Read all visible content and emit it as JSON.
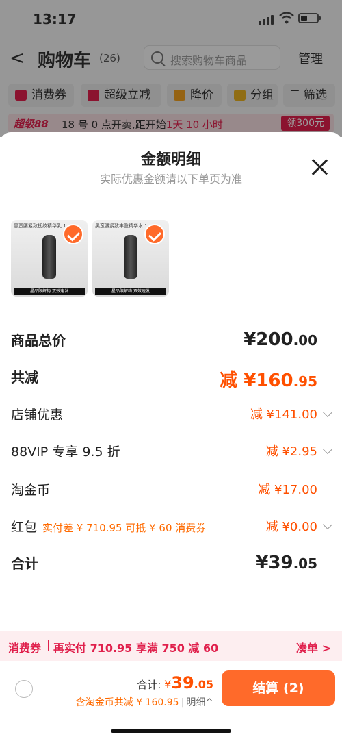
{
  "status_bar": {
    "time": "13:17"
  },
  "nav": {
    "back": "<",
    "title": "购物车",
    "count": "(26)",
    "search_placeholder": "搜索购物车商品",
    "manage": "管理"
  },
  "filters": [
    {
      "label": "消费券",
      "icon": "coupon-icon",
      "color": "#e0204c"
    },
    {
      "label": "超级立减",
      "icon": "arrow-down-icon",
      "color": "#e0204c"
    },
    {
      "label": "降价",
      "icon": "price-drop-icon",
      "color": "#f0a020"
    },
    {
      "label": "分组",
      "icon": "folder-icon",
      "color": "#e8b020"
    },
    {
      "label": "筛选",
      "icon": "filter-icon",
      "color": "#333333"
    }
  ],
  "promo": {
    "brand": "超级88",
    "text_prefix": "18 号 0 点开卖,距开始",
    "countdown": "1天 10 小时",
    "button": "领300元"
  },
  "sheet": {
    "title": "金额明细",
    "subtitle": "实际优惠金额请以下单页为准",
    "products": [
      {
        "caption": "黑蛮腰紧致抚纹精华乳 1",
        "badge": "星品限解构 双效速发"
      },
      {
        "caption": "黑蛮腰紧致丰盈精华水 1",
        "badge": "星品限解构 双效速发"
      }
    ],
    "rows": {
      "goods_total": {
        "label": "商品总价",
        "int": "¥200",
        "dec": ".00"
      },
      "total_reduce": {
        "label": "共减",
        "int": "减 ¥160",
        "dec": ".95"
      },
      "store": {
        "label": "店铺优惠",
        "int": "减 ¥141",
        "dec": ".00"
      },
      "vip": {
        "label": "88VIP 专享 9.5 折",
        "int": "减 ¥2",
        "dec": ".95"
      },
      "coins": {
        "label": "淘金币",
        "int": "减 ¥17",
        "dec": ".00"
      },
      "redpack": {
        "label": "红包",
        "note": "实付差 ¥ 710.95 可抵 ¥ 60 消费券",
        "int": "减 ¥0",
        "dec": ".00"
      },
      "sum": {
        "label": "合计",
        "int": "¥39",
        "dec": ".05"
      }
    }
  },
  "coupon_bar": {
    "label": "消费券",
    "text": "再实付 710.95 享满 750 减 60",
    "action": "凑单 >"
  },
  "checkout": {
    "total_label": "合计:",
    "currency": "¥",
    "amount_int": "39",
    "amount_dec": ".05",
    "detail": "含淘金币共减 ¥ 160.95",
    "detail_link": "明细^",
    "pay_button": "结算 (2)"
  }
}
